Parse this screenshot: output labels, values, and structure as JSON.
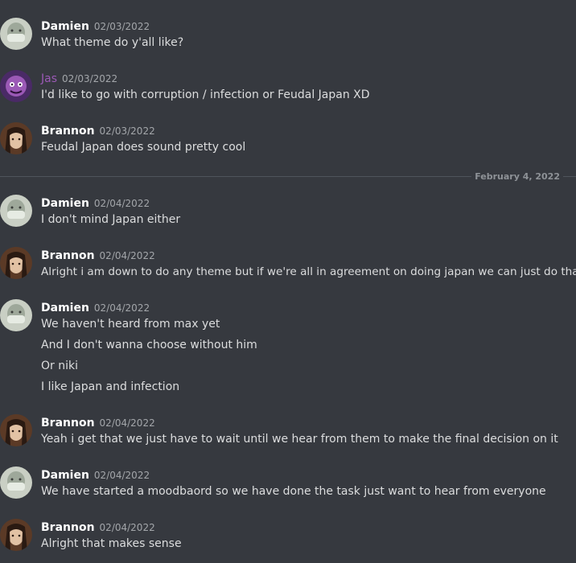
{
  "divider": {
    "label": "February 4, 2022"
  },
  "messages": [
    {
      "user": "Damien",
      "time": "02/03/2022",
      "lines": [
        "What theme do y'all like?"
      ]
    },
    {
      "user": "Jas",
      "time": "02/03/2022",
      "lines": [
        "I'd like to go with corruption / infection or Feudal Japan XD"
      ]
    },
    {
      "user": "Brannon",
      "time": "02/03/2022",
      "lines": [
        "Feudal Japan does sound pretty cool"
      ]
    },
    {
      "user": "Damien",
      "time": "02/04/2022",
      "lines": [
        "I don't mind Japan either"
      ]
    },
    {
      "user": "Brannon",
      "time": "02/04/2022",
      "lines": [
        "Alright i am down to do any theme but if we're all in agreement on doing japan we can just do that"
      ]
    },
    {
      "user": "Damien",
      "time": "02/04/2022",
      "lines": [
        "We haven't heard from max yet",
        "And I don't wanna choose without him",
        "Or niki",
        "I like Japan and infection"
      ]
    },
    {
      "user": "Brannon",
      "time": "02/04/2022",
      "lines": [
        "Yeah i get that we just have to wait until we hear from them to make the final decision on it"
      ]
    },
    {
      "user": "Damien",
      "time": "02/04/2022",
      "lines": [
        "We have started a moodbaord so we have done the task just want to hear from everyone"
      ]
    },
    {
      "user": "Brannon",
      "time": "02/04/2022",
      "lines": [
        "Alright that makes sense"
      ]
    }
  ]
}
